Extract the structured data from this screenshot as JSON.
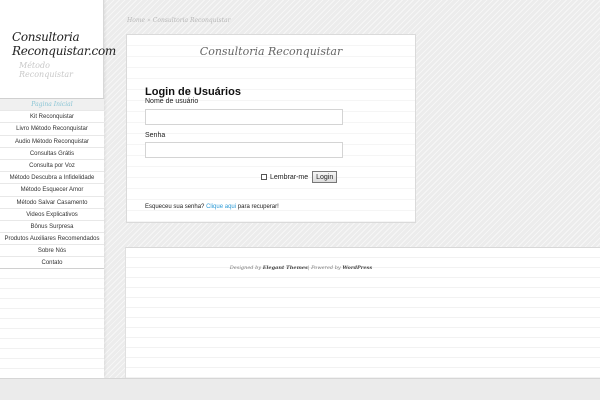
{
  "site": {
    "logo_line1": "Consultoria",
    "logo_line2": "Reconquistar.com",
    "tagline": "Método Reconquistar"
  },
  "sidebar": {
    "items": [
      {
        "label": "Pagina Inicial"
      },
      {
        "label": "Kit Reconquistar"
      },
      {
        "label": "Livro Método Reconquistar"
      },
      {
        "label": "Audio Método Reconquistar"
      },
      {
        "label": "Consultas Grátis"
      },
      {
        "label": "Consulta por Voz"
      },
      {
        "label": "Método Descubra a Infidelidade"
      },
      {
        "label": "Método Esquecer Amor"
      },
      {
        "label": "Método Salvar Casamento"
      },
      {
        "label": "Videos Explicativos"
      },
      {
        "label": "Bônus Surpresa"
      },
      {
        "label": "Produtos Auxiliares Recomendados"
      },
      {
        "label": "Sobre Nós"
      },
      {
        "label": "Contato"
      }
    ]
  },
  "breadcrumb": {
    "home": "Home",
    "separator": "»",
    "current": "Consultoria Reconquistar"
  },
  "content": {
    "title": "Consultoria Reconquistar",
    "heading": "Login de Usuários",
    "username_label": "Nome de usuário",
    "username_value": "",
    "password_label": "Senha",
    "password_value": "",
    "remember_label": "Lembrar-me",
    "login_button": "Login",
    "forgot_text": "Esqueceu sua senha?",
    "forgot_link": "Clique aqui",
    "forgot_suffix": "para recuperar!"
  },
  "footer": {
    "designed_by": "Designed by",
    "theme_author": "Elegant Themes",
    "separator": "|",
    "powered_by": "Powered by",
    "platform": "WordPress"
  }
}
